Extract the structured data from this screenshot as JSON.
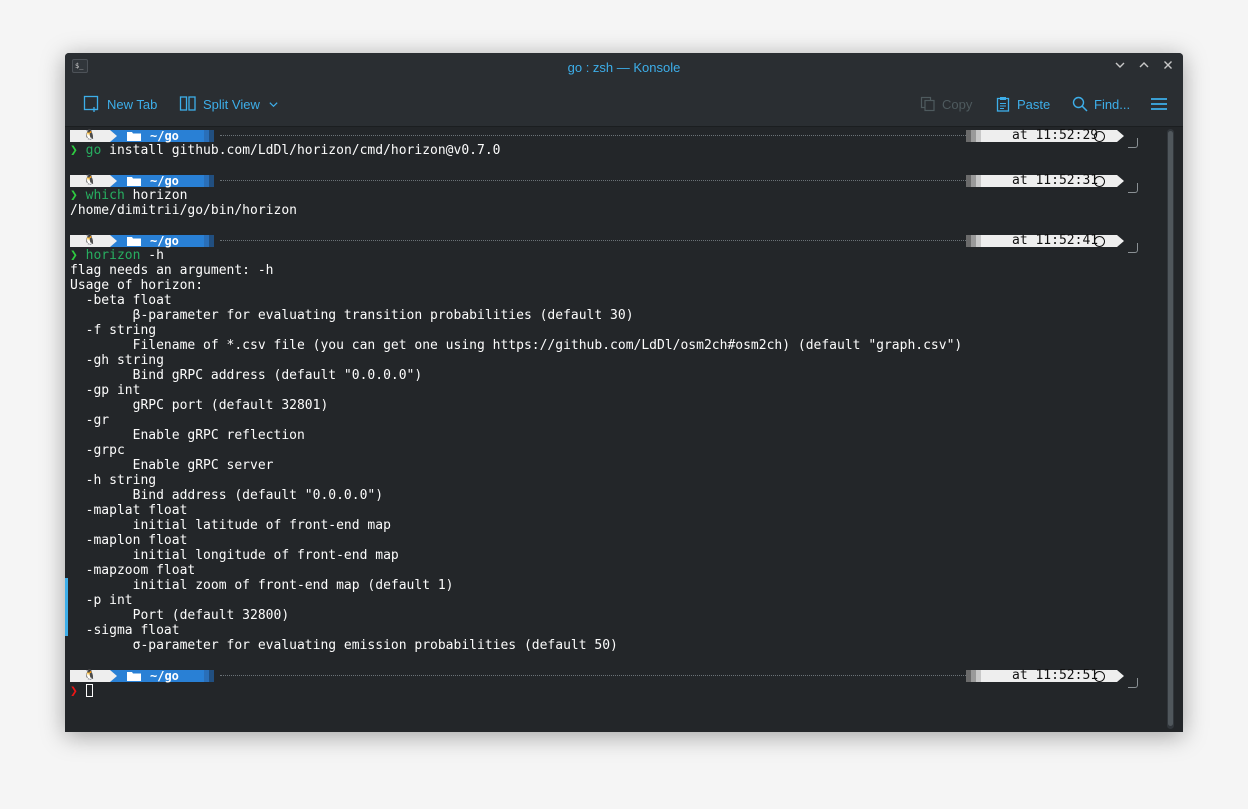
{
  "window": {
    "title": "go : zsh — Konsole",
    "app_icon_glyph": "$_"
  },
  "toolbar": {
    "new_tab": "New Tab",
    "split_view": "Split View",
    "copy": "Copy",
    "paste": "Paste",
    "find": "Find..."
  },
  "prompts": [
    {
      "dir": "~/go",
      "time": "at 11:52:29"
    },
    {
      "dir": "~/go",
      "time": "at 11:52:31"
    },
    {
      "dir": "~/go",
      "time": "at 11:52:41"
    },
    {
      "dir": "~/go",
      "time": "at 11:52:51"
    }
  ],
  "commands": [
    {
      "chevron": "❯",
      "cmd": "go",
      "args": " install github.com/LdDl/horizon/cmd/horizon@v0.7.0"
    },
    {
      "chevron": "❯",
      "cmd": "which",
      "args": " horizon"
    },
    {
      "chevron": "❯",
      "cmd": "horizon",
      "args": " -h"
    },
    {
      "chevron": "❯"
    }
  ],
  "output_which": "/home/dimitrii/go/bin/horizon",
  "output_help": [
    "flag needs an argument: -h",
    "Usage of horizon:",
    "  -beta float",
    "        β-parameter for evaluating transition probabilities (default 30)",
    "  -f string",
    "        Filename of *.csv file (you can get one using https://github.com/LdDl/osm2ch#osm2ch) (default \"graph.csv\")",
    "  -gh string",
    "        Bind gRPC address (default \"0.0.0.0\")",
    "  -gp int",
    "        gRPC port (default 32801)",
    "  -gr",
    "        Enable gRPC reflection",
    "  -grpc",
    "        Enable gRPC server",
    "  -h string",
    "        Bind address (default \"0.0.0.0\")",
    "  -maplat float",
    "        initial latitude of front-end map",
    "  -maplon float",
    "        initial longitude of front-end map",
    "  -mapzoom float",
    "        initial zoom of front-end map (default 1)",
    "  -p int",
    "        Port (default 32800)",
    "  -sigma float",
    "        σ-parameter for evaluating emission probabilities (default 50)"
  ],
  "colors": {
    "accent": "#3daee9",
    "terminal_bg": "#232629",
    "prompt_green": "#2ecc40",
    "prompt_error": "#ed1515",
    "dir_segment": "#2980d5"
  }
}
